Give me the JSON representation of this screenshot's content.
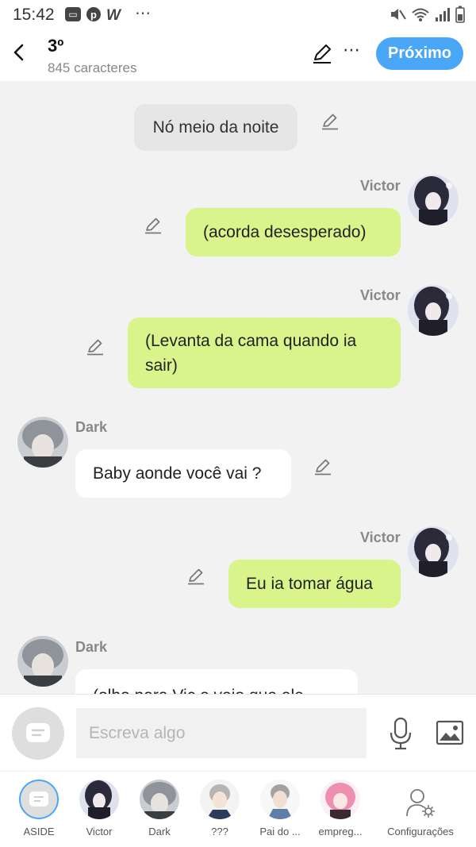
{
  "status_bar": {
    "time": "15:42",
    "more": "⋯"
  },
  "header": {
    "title": "3º",
    "subtitle": "845 caracteres",
    "more": "⋯",
    "next_label": "Próximo"
  },
  "messages": [
    {
      "type": "narration",
      "text": "Nó meio da noite"
    },
    {
      "type": "right",
      "speaker": "Victor",
      "text": "(acorda desesperado)"
    },
    {
      "type": "right",
      "speaker": "Victor",
      "text": "(Levanta da cama quando ia sair)"
    },
    {
      "type": "left",
      "speaker": "Dark",
      "text": "Baby aonde você vai ?"
    },
    {
      "type": "right",
      "speaker": "Victor",
      "text": "Eu ia tomar água"
    },
    {
      "type": "left",
      "speaker": "Dark",
      "text": "(olho para Vic e vejo que ele"
    }
  ],
  "composer": {
    "placeholder": "Escreva algo"
  },
  "tabs": [
    {
      "label": "ASIDE"
    },
    {
      "label": "Victor"
    },
    {
      "label": "Dark"
    },
    {
      "label": "???"
    },
    {
      "label": "Pai do ..."
    },
    {
      "label": "empreg..."
    },
    {
      "label": "Configurações"
    }
  ],
  "colors": {
    "accent": "#4aa6f6",
    "user_bubble": "#d8f48a",
    "narration_bubble": "#e6e6e6",
    "other_bubble": "#ffffff",
    "background": "#f2f2f2"
  },
  "icons": [
    "back-arrow-icon",
    "pencil-icon",
    "more-icon",
    "mic-icon",
    "image-icon",
    "settings-user-icon",
    "chat-bubble-icon"
  ]
}
